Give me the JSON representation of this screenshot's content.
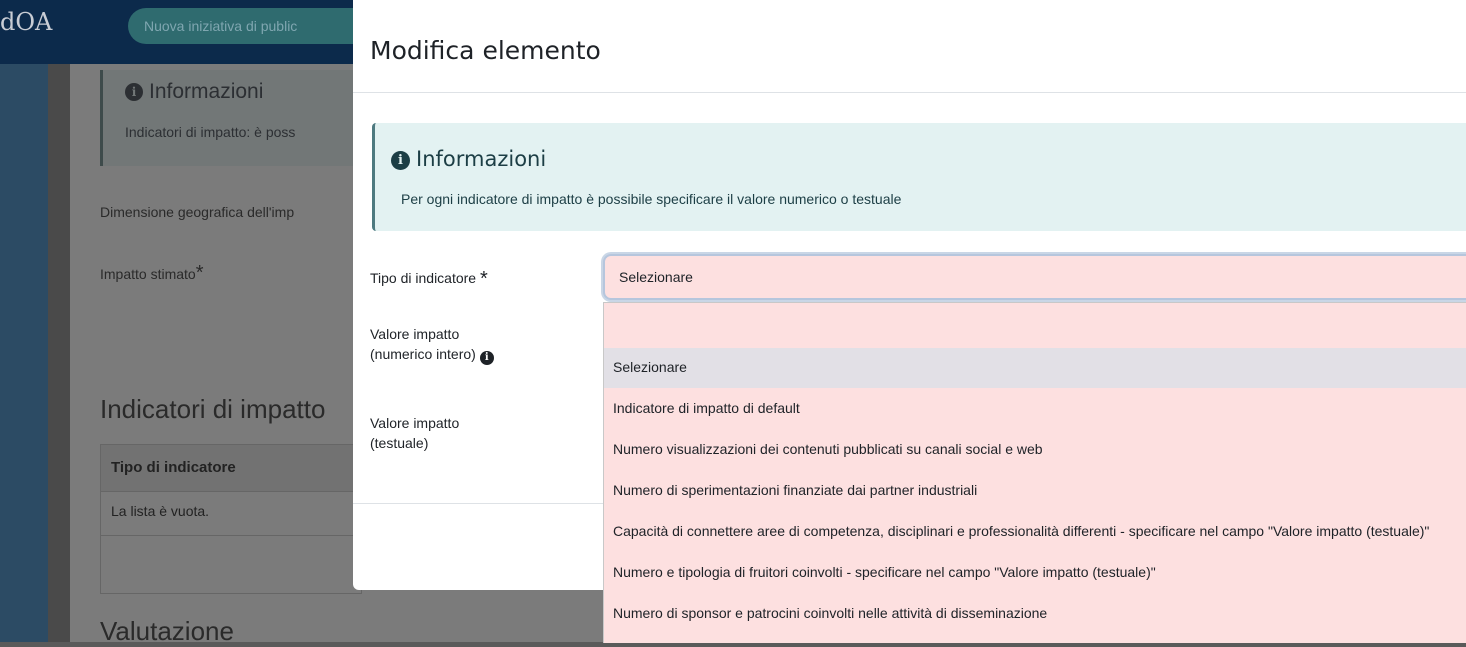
{
  "background": {
    "logo": "dOA",
    "pill": "Nuova iniziativa di public",
    "info_title": "Informazioni",
    "info_text": "Indicatori di impatto: è poss",
    "geo_label": "Dimensione geografica dell'imp",
    "impact_label": "Impatto stimato",
    "section_title": "Indicatori di impatto",
    "table_header": "Tipo di indicatore",
    "table_empty": "La lista è vuota.",
    "valutazione": "Valutazione"
  },
  "modal": {
    "title": "Modifica elemento",
    "alert": {
      "title": "Informazioni",
      "text": "Per ogni indicatore di impatto è possibile specificare il valore numerico o testuale"
    },
    "fields": {
      "tipo_label": "Tipo di indicatore",
      "valore_num_label_1": "Valore impatto",
      "valore_num_label_2": "(numerico intero)",
      "valore_txt_label_1": "Valore impatto",
      "valore_txt_label_2": "(testuale)"
    },
    "select": {
      "value": "Selezionare",
      "options": [
        "Selezionare",
        "Indicatore di impatto di default",
        "Numero visualizzazioni dei contenuti pubblicati su canali social e web",
        "Numero di sperimentazioni finanziate dai partner industriali",
        "Capacità di connettere aree di competenza, disciplinari e professionalità differenti - specificare nel campo \"Valore impatto (testuale)\"",
        "Numero e tipologia di fruitori coinvolti - specificare nel campo \"Valore impatto (testuale)\"",
        "Numero di sponsor e patrocini coinvolti nelle attività di disseminazione"
      ]
    }
  },
  "icons": {
    "info": "info-circle-icon",
    "required": "asterisk-icon"
  },
  "colors": {
    "error_bg": "#fde0e0",
    "alert_bg": "#e3f2f2",
    "header_bg": "#0c2a4b"
  }
}
